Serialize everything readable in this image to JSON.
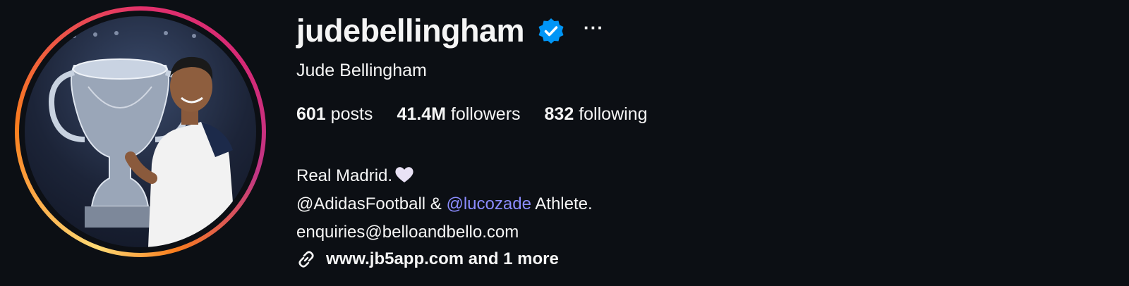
{
  "profile": {
    "username": "judebellingham",
    "verified": true,
    "more_label": "···",
    "full_name": "Jude Bellingham",
    "avatar_icon": "profile-photo",
    "ring_colors": [
      "#feda75",
      "#fa7e1e",
      "#e1306c",
      "#d62976",
      "#c13584"
    ]
  },
  "stats": [
    {
      "count": "601",
      "label": "posts"
    },
    {
      "count": "41.4M",
      "label": "followers"
    },
    {
      "count": "832",
      "label": "following"
    }
  ],
  "bio": {
    "line1": "Real Madrid.",
    "line1_emoji": "white-heart-icon",
    "line2_prefix": "@AdidasFootball & ",
    "line2_mention": "@lucozade",
    "line2_suffix": " Athlete.",
    "line3": "enquiries@belloandbello.com"
  },
  "link": {
    "icon": "link-icon",
    "text": "www.jb5app.com and 1 more"
  },
  "colors": {
    "background": "#0c0f14",
    "text": "#f5f5f5",
    "mention": "#8b8cff",
    "verified": "#0095f6"
  }
}
